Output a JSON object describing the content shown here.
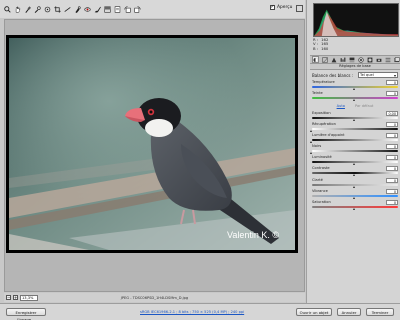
{
  "toolbar": {
    "tools": [
      "zoom-icon",
      "hand-icon",
      "white-balance-icon",
      "color-sampler-icon",
      "target-adjust-icon",
      "crop-icon",
      "straighten-icon",
      "spot-removal-icon",
      "red-eye-icon",
      "adjustment-brush-icon",
      "graduated-filter-icon",
      "preferences-icon",
      "rotate-left-icon",
      "rotate-right-icon"
    ],
    "preview_label": "Aperçu",
    "preview_checked": true
  },
  "photo": {
    "watermark": "Valentin K. ©"
  },
  "zoom": {
    "minus": "−",
    "plus": "+",
    "value": "13,3%"
  },
  "filename": "JPEG - TDSC06PSD_1H4LDSMm_D.jpg",
  "histogram": {
    "rgb": [
      {
        "label": "R :",
        "value": "162"
      },
      {
        "label": "V :",
        "value": "165"
      },
      {
        "label": "B :",
        "value": "160"
      }
    ]
  },
  "panel": {
    "title": "Réglages de base",
    "white_balance_label": "Balance des blancs :",
    "white_balance_value": "Tel quel",
    "auto_label": "Auto",
    "default_label": "Par défaut",
    "sliders": [
      {
        "label": "Température",
        "value": "0",
        "position": 0.5
      },
      {
        "label": "Teinte",
        "value": "0",
        "position": 0.5
      },
      {
        "label": "Exposition",
        "value": "0,00",
        "position": 0.5
      },
      {
        "label": "Récupération",
        "value": "0",
        "position": 0.0
      },
      {
        "label": "Lumière d'appoint",
        "value": "0",
        "position": 0.0
      },
      {
        "label": "Noirs",
        "value": "0",
        "position": 0.0
      },
      {
        "label": "Luminosité",
        "value": "0",
        "position": 0.5
      },
      {
        "label": "Contraste",
        "value": "0",
        "position": 0.5
      },
      {
        "label": "Clarté",
        "value": "0",
        "position": 0.5
      },
      {
        "label": "Vibrance",
        "value": "0",
        "position": 0.5
      },
      {
        "label": "Saturation",
        "value": "0",
        "position": 0.5
      }
    ]
  },
  "bottom": {
    "save_label": "Enregistrer l'image...",
    "workflow_text": "sRGB IEC61966-2.1 ; 8 bits ; 750 × 525 (0,4 MP) ; 240 ppi",
    "open_label": "Ouvrir un objet",
    "cancel_label": "Annuler",
    "done_label": "Terminer"
  },
  "colors": {
    "temperature_track": [
      "#2f66e0",
      "#f0d230"
    ],
    "tint_track": [
      "#3fbf3f",
      "#d040d0"
    ],
    "vibrance_track": [
      "#b0b0b0",
      "#3090ff"
    ],
    "saturation_track": [
      "#808080",
      "#ff3a3a"
    ],
    "accent_link": "#1a56c4"
  }
}
